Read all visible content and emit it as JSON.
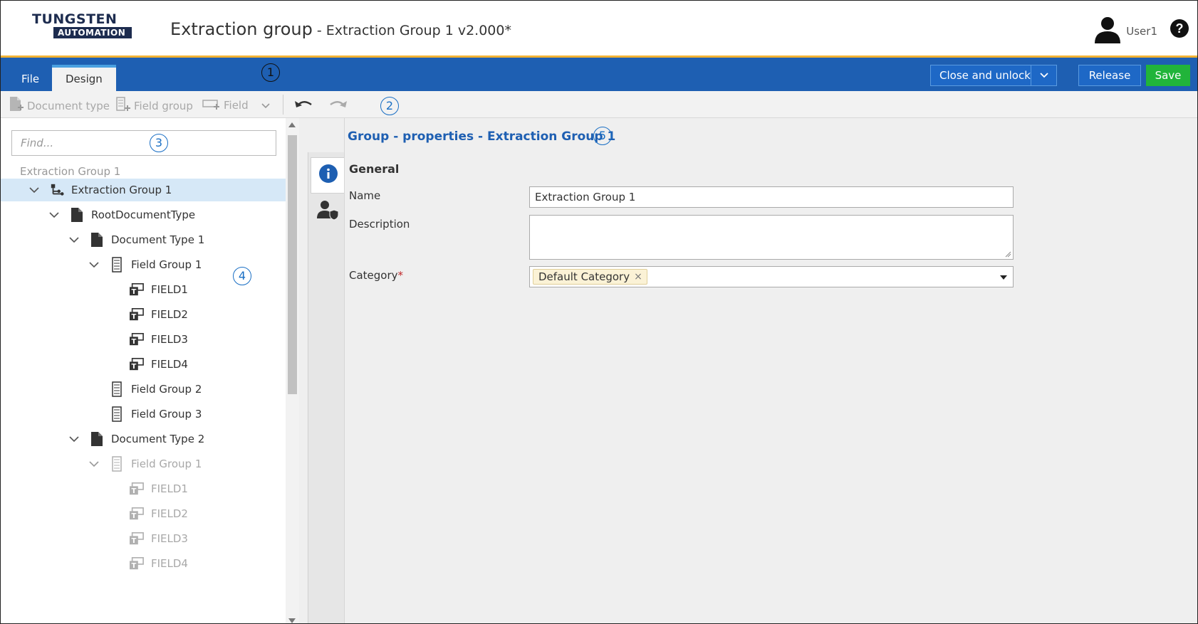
{
  "header": {
    "logo_top": "TUNGSTEN",
    "logo_bottom": "AUTOMATION",
    "title": "Extraction group",
    "subtitle": " - Extraction Group 1 v2.000*",
    "user_name": "User1",
    "help_glyph": "?"
  },
  "ribbon": {
    "tabs": [
      {
        "label": "File",
        "active": false
      },
      {
        "label": "Design",
        "active": true
      }
    ],
    "close_unlock_label": "Close and unlock",
    "release_label": "Release",
    "save_label": "Save",
    "colors": {
      "ribbon": "#1e5fb2",
      "save": "#21b43a",
      "accent_line": "#f2b233"
    }
  },
  "toolbar": {
    "document_type_label": "Document type",
    "field_group_label": "Field group",
    "field_label": "Field"
  },
  "callouts": [
    "1",
    "2",
    "3",
    "4",
    "5"
  ],
  "left": {
    "find_placeholder": "Find...",
    "breadcrumb": "Extraction Group 1",
    "tree": [
      {
        "label": "Extraction Group 1",
        "icon": "group-tree-icon",
        "expanded": true,
        "selected": true,
        "disabled": false
      },
      {
        "label": "RootDocumentType",
        "icon": "document-icon",
        "expanded": true,
        "selected": false,
        "disabled": false
      },
      {
        "label": "Document Type 1",
        "icon": "document-icon",
        "expanded": true,
        "selected": false,
        "disabled": false
      },
      {
        "label": "Field Group 1",
        "icon": "field-group-icon",
        "expanded": true,
        "selected": false,
        "disabled": false
      },
      {
        "label": "FIELD1",
        "icon": "text-field-icon",
        "expanded": null,
        "selected": false,
        "disabled": false
      },
      {
        "label": "FIELD2",
        "icon": "text-field-icon",
        "expanded": null,
        "selected": false,
        "disabled": false
      },
      {
        "label": "FIELD3",
        "icon": "text-field-icon",
        "expanded": null,
        "selected": false,
        "disabled": false
      },
      {
        "label": "FIELD4",
        "icon": "text-field-icon",
        "expanded": null,
        "selected": false,
        "disabled": false
      },
      {
        "label": "Field Group 2",
        "icon": "field-group-icon",
        "expanded": null,
        "selected": false,
        "disabled": false
      },
      {
        "label": "Field Group 3",
        "icon": "field-group-icon",
        "expanded": null,
        "selected": false,
        "disabled": false
      },
      {
        "label": "Document Type 2",
        "icon": "document-icon",
        "expanded": true,
        "selected": false,
        "disabled": false
      },
      {
        "label": "Field Group 1",
        "icon": "field-group-icon",
        "expanded": true,
        "selected": false,
        "disabled": true
      },
      {
        "label": "FIELD1",
        "icon": "text-field-icon",
        "expanded": null,
        "selected": false,
        "disabled": true
      },
      {
        "label": "FIELD2",
        "icon": "text-field-icon",
        "expanded": null,
        "selected": false,
        "disabled": true
      },
      {
        "label": "FIELD3",
        "icon": "text-field-icon",
        "expanded": null,
        "selected": false,
        "disabled": true
      },
      {
        "label": "FIELD4",
        "icon": "text-field-icon",
        "expanded": null,
        "selected": false,
        "disabled": true
      }
    ]
  },
  "properties": {
    "title": "Group  - properties - Extraction Group 1",
    "section": "General",
    "name_label": "Name",
    "name_value": "Extraction Group 1",
    "description_label": "Description",
    "description_value": "",
    "category_label": "Category",
    "category_required": "*",
    "category_value": "Default Category",
    "chip_remove": "×"
  }
}
